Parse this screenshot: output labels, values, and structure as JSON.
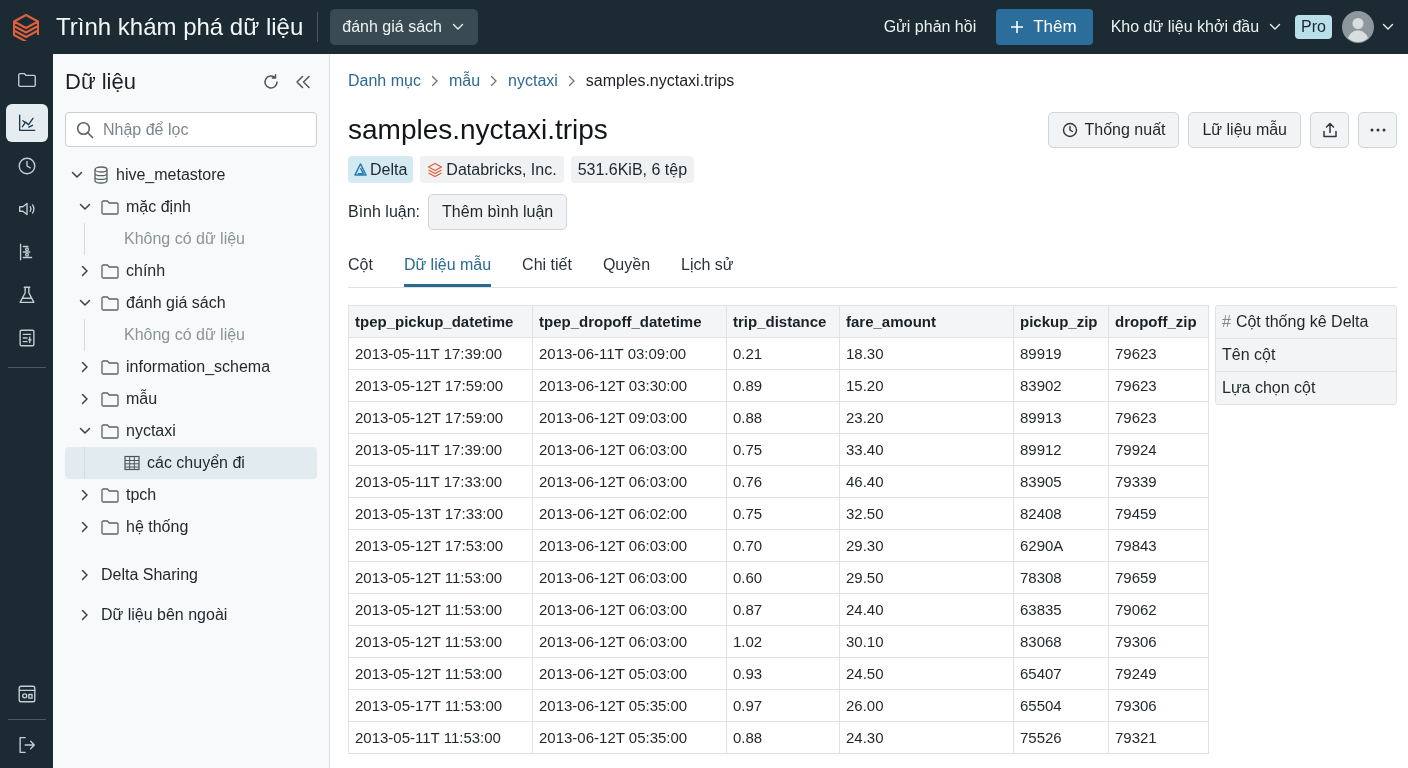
{
  "top_bar": {
    "app_title": "Trình khám phá dữ liệu",
    "workspace_dropdown": "đánh giá sách",
    "feedback_link": "Gửi phản hồi",
    "add_button": "Thêm",
    "warehouse_dropdown": "Kho dữ liệu khởi đầu",
    "plan_badge": "Pro"
  },
  "nav_rail": {
    "top_items": [
      {
        "selected": false
      },
      {
        "selected": true
      },
      {
        "selected": false
      },
      {
        "selected": false
      },
      {
        "selected": false
      },
      {
        "selected": false
      },
      {
        "selected": false
      }
    ],
    "bottom_items": [
      {
        "selected": false
      },
      {
        "selected": false
      }
    ]
  },
  "sidebar": {
    "title": "Dữ liệu",
    "filter": {
      "placeholder": "Nhập để lọc"
    },
    "tree": [
      {
        "label": "hive_metastore",
        "kind": "catalog",
        "expanded": true,
        "selected": false,
        "children": [
          {
            "label": "mặc định",
            "kind": "schema",
            "expanded": true,
            "selected": false,
            "empty_text": "Không có dữ liệu"
          },
          {
            "label": "chính",
            "kind": "schema",
            "expanded": false,
            "selected": false
          },
          {
            "label": "đánh giá sách",
            "kind": "schema",
            "expanded": true,
            "selected": false,
            "empty_text": "Không có dữ liệu"
          },
          {
            "label": "information_schema",
            "kind": "schema",
            "expanded": false,
            "selected": false
          },
          {
            "label": "mẫu",
            "kind": "schema",
            "expanded": false,
            "selected": false
          },
          {
            "label": "nyctaxi",
            "kind": "schema",
            "expanded": true,
            "selected": false,
            "children": [
              {
                "label": "các chuyển đi",
                "kind": "table",
                "selected": true
              }
            ]
          },
          {
            "label": "tpch",
            "kind": "schema",
            "expanded": false,
            "selected": false
          },
          {
            "label": "hệ thống",
            "kind": "schema",
            "expanded": false,
            "selected": false
          }
        ]
      },
      {
        "label": "Delta Sharing",
        "kind": "section",
        "expanded": false,
        "selected": false
      },
      {
        "label": "Dữ liệu bên ngoài",
        "kind": "section",
        "expanded": false,
        "selected": false
      }
    ]
  },
  "main": {
    "breadcrumb": [
      {
        "label": "Danh mục",
        "link": true
      },
      {
        "label": "mẫu",
        "link": true
      },
      {
        "label": "nyctaxi",
        "link": true
      },
      {
        "label": "samples.nyctaxi.trips",
        "link": false
      }
    ],
    "title": "samples.nyctaxi.trips",
    "actions": [
      {
        "kind": "clock_label",
        "label": "Thống nuất"
      },
      {
        "kind": "label",
        "label": "Lữ liệu mẫu"
      },
      {
        "kind": "upload_icon"
      },
      {
        "kind": "more_icon"
      }
    ],
    "badges": [
      {
        "kind": "format",
        "label": "Delta"
      },
      {
        "kind": "owner",
        "label": "Databricks, Inc."
      },
      {
        "kind": "size",
        "label": "531.6KiB, 6 tệp"
      }
    ],
    "comment": {
      "label": "Bình luận:",
      "button": "Thêm bình luận"
    },
    "tabs": [
      {
        "label": "Cột",
        "selected": false
      },
      {
        "label": "Dữ liệu mẫu",
        "selected": true
      },
      {
        "label": "Chi tiết",
        "selected": false
      },
      {
        "label": "Quyền",
        "selected": false
      },
      {
        "label": "Lịch sử",
        "selected": false
      }
    ],
    "table": {
      "columns": [
        "tpep_pickup_datetime",
        "tpep_dropoff_datetime",
        "trip_distance",
        "fare_amount",
        "pickup_zip",
        "dropoff_zip"
      ],
      "rows": [
        [
          "2013-05-11T 17:39:00",
          "2013-06-11T 03:09:00",
          "0.21",
          "18.30",
          "89919",
          "79623"
        ],
        [
          "2013-05-12T 17:59:00",
          "2013-06-12T 03:30:00",
          "0.89",
          "15.20",
          "83902",
          "79623"
        ],
        [
          "2013-05-12T 17:59:00",
          "2013-06-12T 09:03:00",
          "0.88",
          "23.20",
          "89913",
          "79623"
        ],
        [
          "2013-05-11T 17:39:00",
          "2013-06-12T 06:03:00",
          "0.75",
          "33.40",
          "89912",
          "79924"
        ],
        [
          "2013-05-11T 17:33:00",
          "2013-06-12T 06:03:00",
          "0.76",
          "46.40",
          "83905",
          "79339"
        ],
        [
          "2013-05-13T 17:33:00",
          "2013-06-12T 06:02:00",
          "0.75",
          "32.50",
          "82408",
          "79459"
        ],
        [
          "2013-05-12T 17:53:00",
          "2013-06-12T 06:03:00",
          "0.70",
          "29.30",
          "6290A",
          "79843"
        ],
        [
          "2013-05-12T 11:53:00",
          "2013-06-12T 06:03:00",
          "0.60",
          "29.50",
          "78308",
          "79659"
        ],
        [
          "2013-05-12T 11:53:00",
          "2013-06-12T 06:03:00",
          "0.87",
          "24.40",
          "63835",
          "79062"
        ],
        [
          "2013-05-12T 11:53:00",
          "2013-06-12T 06:03:00",
          "1.02",
          "30.10",
          "83068",
          "79306"
        ],
        [
          "2013-05-12T 11:53:00",
          "2013-06-12T 05:03:00",
          "0.93",
          "24.50",
          "65407",
          "79249"
        ],
        [
          "2013-05-17T 11:53:00",
          "2013-06-12T 05:35:00",
          "0.97",
          "26.00",
          "65504",
          "79306"
        ],
        [
          "2013-05-11T 11:53:00",
          "2013-06-12T 05:35:00",
          "0.88",
          "24.30",
          "75526",
          "79321"
        ]
      ]
    },
    "stats_panel": {
      "title_icon": "#",
      "title": "Cột thống kê Delta",
      "items": [
        "Tên cột",
        "Lựa chọn cột"
      ]
    }
  }
}
